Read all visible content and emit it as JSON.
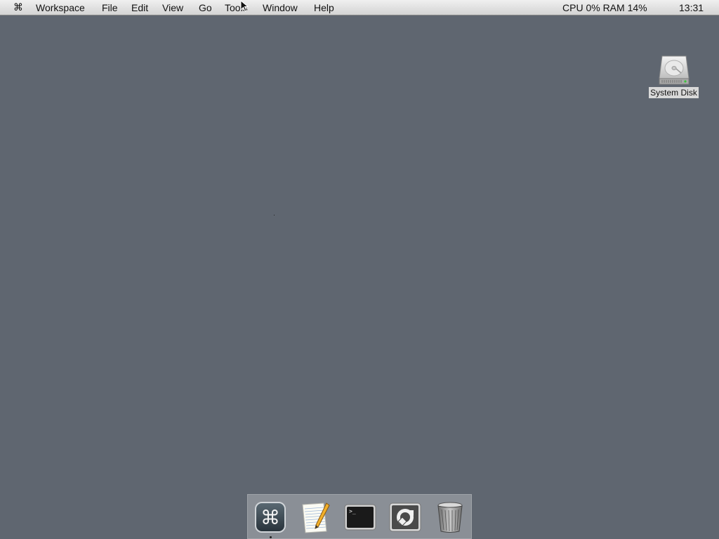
{
  "menubar": {
    "apple_symbol": "⌘",
    "items": [
      "Workspace",
      "File",
      "Edit",
      "View",
      "Go",
      "Tools",
      "Window",
      "Help"
    ],
    "status": "CPU 0% RAM 14%",
    "clock": "13:31"
  },
  "desktop": {
    "icons": [
      {
        "label": "System Disk",
        "icon": "hard-disk-icon"
      }
    ]
  },
  "dock": {
    "items": [
      {
        "icon": "command-key-icon",
        "running": true
      },
      {
        "icon": "text-editor-notepad-icon",
        "running": false
      },
      {
        "icon": "terminal-icon",
        "running": false
      },
      {
        "icon": "system-preferences-icon",
        "running": false
      },
      {
        "icon": "trash-can-icon",
        "running": false
      }
    ]
  },
  "colors": {
    "desktop_bg": "#5f6670",
    "menubar_bg": "#e4e4e4",
    "dock_bg": "#8a8f96"
  }
}
